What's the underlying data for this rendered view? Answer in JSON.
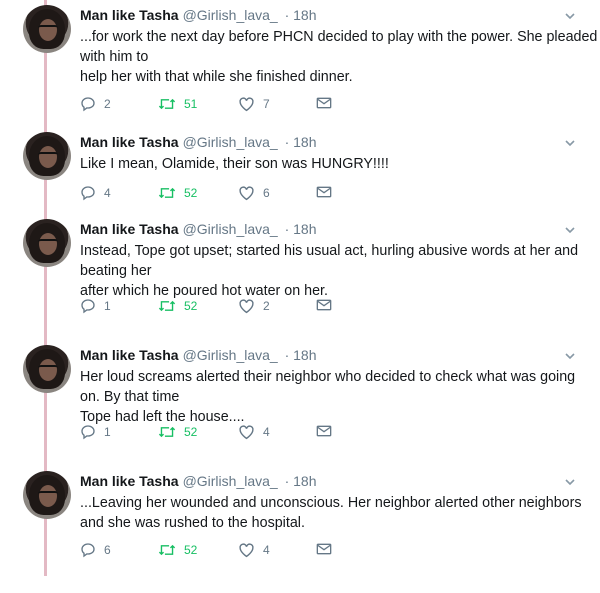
{
  "tweets": [
    {
      "author": "Man like Tasha",
      "handle": "@Girlish_lava_",
      "time": "· 18h",
      "lines": [
        "...for work the next day before PHCN decided to play with the power. She pleaded",
        "with him to",
        "help her with that while she finished dinner."
      ],
      "replies": "2",
      "retweets": "51",
      "likes": "7"
    },
    {
      "author": "Man like Tasha",
      "handle": "@Girlish_lava_",
      "time": "· 18h",
      "lines": [
        "Like I mean, Olamide, their son was HUNGRY!!!!"
      ],
      "replies": "4",
      "retweets": "52",
      "likes": "6"
    },
    {
      "author": "Man like Tasha",
      "handle": "@Girlish_lava_",
      "time": "· 18h",
      "lines": [
        "Instead, Tope got upset; started his usual act, hurling abusive words at her and",
        "beating her",
        "after which he poured hot water on her."
      ],
      "replies": "1",
      "retweets": "52",
      "likes": "2"
    },
    {
      "author": "Man like Tasha",
      "handle": "@Girlish_lava_",
      "time": "· 18h",
      "lines": [
        "Her loud screams alerted their neighbor who decided to check what was going",
        "on. By that time",
        "Tope had left the house...."
      ],
      "replies": "1",
      "retweets": "52",
      "likes": "4"
    },
    {
      "author": "Man like Tasha",
      "handle": "@Girlish_lava_",
      "time": "· 18h",
      "lines": [
        "...Leaving her wounded and unconscious. Her neighbor alerted other neighbors",
        "and she was rushed to the hospital."
      ],
      "replies": "6",
      "retweets": "52",
      "likes": "4"
    }
  ],
  "colors": {
    "thread": "#e3b9c4",
    "retweet": "#17bf63",
    "muted": "#657786",
    "text": "#14171a"
  },
  "icons": [
    "reply-icon",
    "retweet-icon",
    "heart-icon",
    "direct-message-icon",
    "chevron-down-icon"
  ]
}
